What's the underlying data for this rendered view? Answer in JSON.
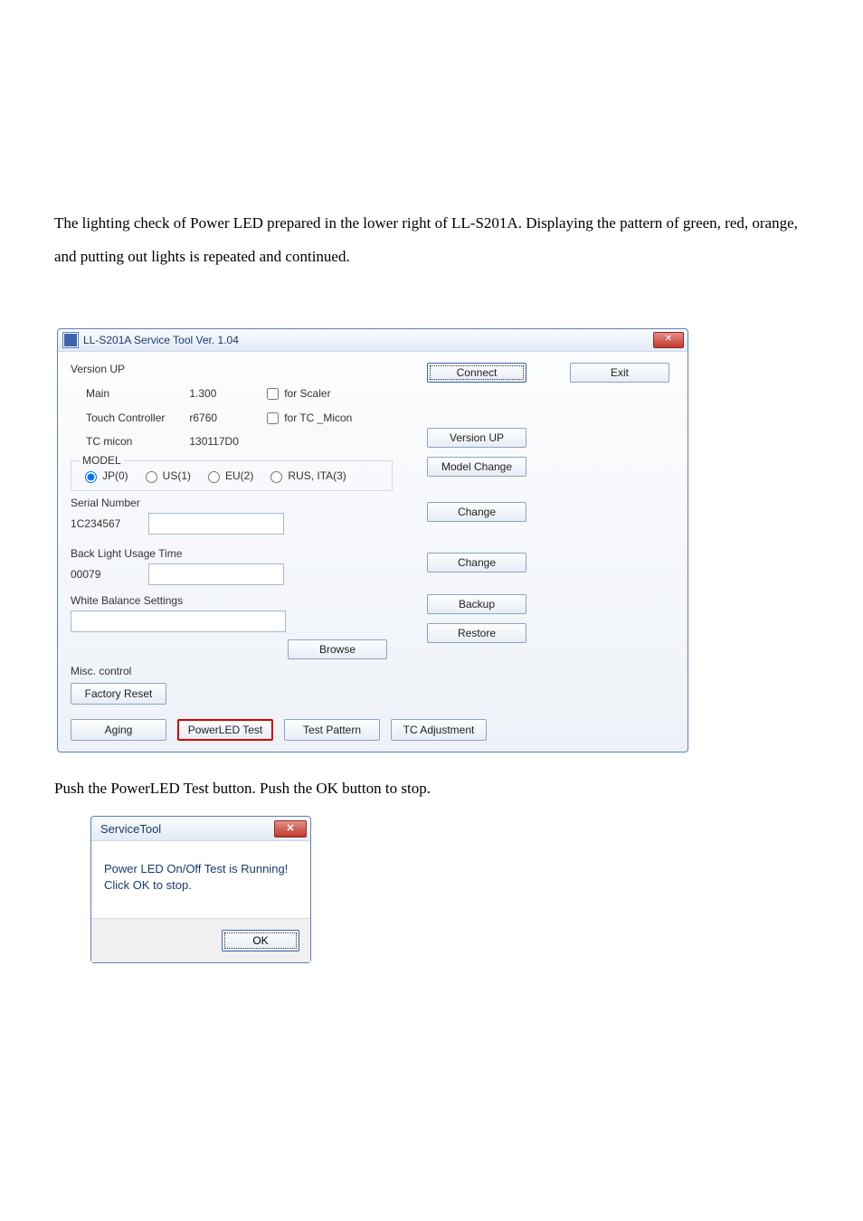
{
  "intro_text": "The lighting check of Power LED prepared in the lower right of LL-S201A. Displaying the pattern of green, red, orange, and putting out lights is repeated and continued.",
  "window": {
    "title": "LL-S201A Service Tool  Ver. 1.04",
    "version_up_label": "Version UP",
    "main_label": "Main",
    "main_value": "1.300",
    "touch_label": "Touch Controller",
    "touch_value": "r6760",
    "tc_micon_label": "TC micon",
    "tc_micon_value": "130117D0",
    "chk_scaler": "for Scaler",
    "chk_tcmicon": "for TC _Micon",
    "model_legend": "MODEL",
    "model_options": [
      "JP(0)",
      "US(1)",
      "EU(2)",
      "RUS, ITA(3)"
    ],
    "serial_label": "Serial Number",
    "serial_value": "1C234567",
    "backlight_label": "Back Light Usage Time",
    "backlight_value": "00079",
    "wbs_label": "White Balance Settings",
    "misc_label": "Misc. control",
    "buttons": {
      "connect": "Connect",
      "exit": "Exit",
      "version_up": "Version UP",
      "model_change": "Model Change",
      "change": "Change",
      "backup": "Backup",
      "browse": "Browse",
      "restore": "Restore",
      "factory_reset": "Factory Reset",
      "aging": "Aging",
      "powerled": "PowerLED Test",
      "test_pattern": "Test Pattern",
      "tc_adjust": "TC Adjustment"
    }
  },
  "mid_text": "Push the PowerLED Test button. Push the OK button to stop.",
  "dialog": {
    "title": "ServiceTool",
    "line1": "Power LED On/Off Test is Running!",
    "line2": "Click OK to stop.",
    "ok": "OK"
  }
}
